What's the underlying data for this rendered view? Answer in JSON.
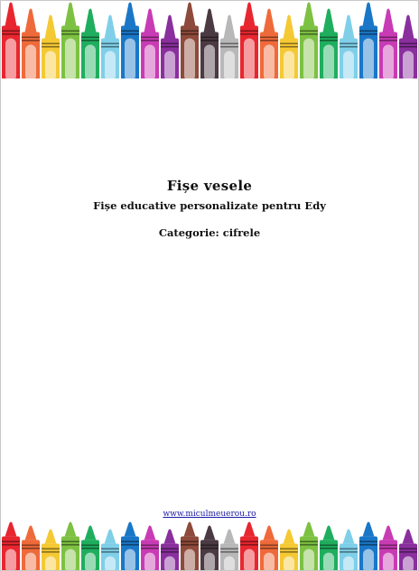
{
  "document": {
    "title": "Fișe  vesele",
    "subtitle": "Fișe educative personalizate pentru Edy",
    "category_line": "Categorie: cifrele",
    "footer_url": "www.miculmeuerou.ro"
  },
  "crayon_palette": [
    "#e8262f",
    "#ef6a3a",
    "#f5c934",
    "#7dc142",
    "#1fae5e",
    "#7fcfe9",
    "#1a77c8",
    "#c83bb4",
    "#8a2f9e",
    "#8e4a3a",
    "#4b3a42",
    "#b8b8b8"
  ]
}
